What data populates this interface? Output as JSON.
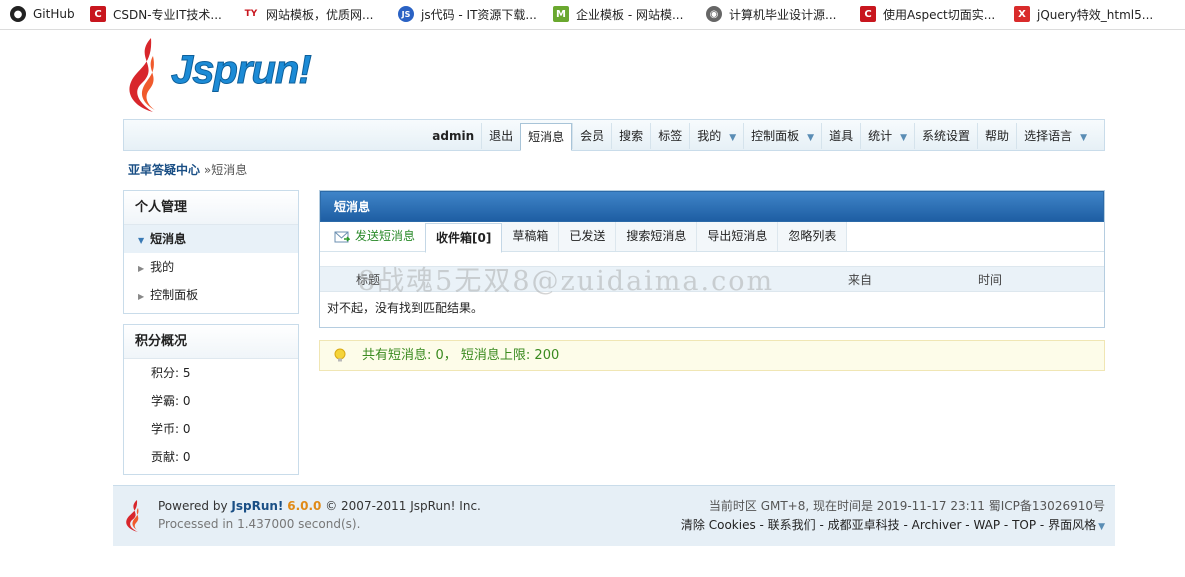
{
  "bookmarks": [
    {
      "label": "GitHub",
      "icon": "github-icon",
      "color": "#222222",
      "glyph": "●"
    },
    {
      "label": "CSDN-专业IT技术...",
      "icon": "csdn-icon",
      "color": "#c8161e",
      "glyph": "C"
    },
    {
      "label": "网站模板，优质网...",
      "icon": "ty-icon",
      "color": "#ffffff",
      "glyph": "TY"
    },
    {
      "label": "js代码 - IT资源下载...",
      "icon": "js-icon",
      "color": "#2a62c4",
      "glyph": "JS"
    },
    {
      "label": "企业模板 - 网站模...",
      "icon": "m-icon",
      "color": "#6aa82f",
      "glyph": "M"
    },
    {
      "label": "计算机毕业设计源...",
      "icon": "globe-icon",
      "color": "#666666",
      "glyph": "◉"
    },
    {
      "label": "使用Aspect切面实...",
      "icon": "csdn-icon",
      "color": "#c8161e",
      "glyph": "C"
    },
    {
      "label": "jQuery特效_html5...",
      "icon": "jq-icon",
      "color": "#d92b2b",
      "glyph": "X"
    }
  ],
  "logo": {
    "text": "Jsprun!"
  },
  "nav": {
    "user": "admin",
    "items": [
      "退出",
      "短消息",
      "会员",
      "搜索",
      "标签",
      "我的",
      "控制面板",
      "道具",
      "统计",
      "系统设置",
      "帮助",
      "选择语言"
    ],
    "active": "短消息"
  },
  "breadcrumb": {
    "home": "亚卓答疑中心",
    "separator": "»",
    "current": "短消息"
  },
  "personal": {
    "title": "个人管理",
    "items": [
      {
        "label": "短消息",
        "current": true
      },
      {
        "label": "我的",
        "current": false
      },
      {
        "label": "控制面板",
        "current": false
      }
    ]
  },
  "credits": {
    "title": "积分概况",
    "rows": [
      {
        "label": "积分",
        "value": "5"
      },
      {
        "label": "学霸",
        "value": "0"
      },
      {
        "label": "学币",
        "value": "0"
      },
      {
        "label": "贡献",
        "value": "0"
      }
    ]
  },
  "main": {
    "title": "短消息",
    "tabs": [
      "发送短消息",
      "收件箱[0]",
      "草稿箱",
      "已发送",
      "搜索短消息",
      "导出短消息",
      "忽略列表"
    ],
    "active_tab": "收件箱[0]",
    "columns": [
      "标题",
      "来自",
      "时间"
    ],
    "empty_text": "对不起，没有找到匹配结果。",
    "notice": "共有短消息: 0， 短消息上限: 200"
  },
  "watermark": "8战魂5无双8@zuidaima.com",
  "footer": {
    "powered_prefix": "Powered by",
    "brand": "JspRun!",
    "version": "6.0.0",
    "copyright": "© 2007-2011 JspRun! Inc.",
    "processed": "Processed in 1.437000 second(s).",
    "timezone": "当前时区 GMT+8, 现在时间是 2019-11-17 23:11 蜀ICP备13026910号",
    "links": [
      "清除 Cookies",
      "联系我们",
      "成都亚卓科技",
      "Archiver",
      "WAP",
      "TOP",
      "界面风格"
    ]
  },
  "colors": {
    "accent": "#1e5ea3",
    "notice_text": "#3a8a1f",
    "brand": "#1a4f85",
    "version": "#e08a17"
  }
}
